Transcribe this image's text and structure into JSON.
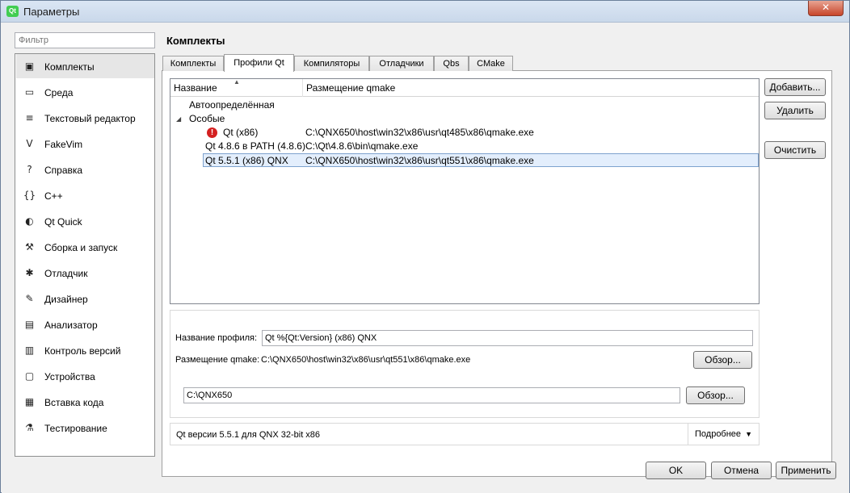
{
  "window": {
    "title": "Параметры",
    "app_icon": "Qt",
    "close_glyph": "✕"
  },
  "filter": {
    "placeholder": "Фильтр"
  },
  "categories": [
    {
      "label": "Комплекты",
      "icon": "kits-icon",
      "glyph": "▣",
      "selected": true
    },
    {
      "label": "Среда",
      "icon": "monitor-icon",
      "glyph": "▭"
    },
    {
      "label": "Текстовый редактор",
      "icon": "text-editor-icon",
      "glyph": "≡"
    },
    {
      "label": "FakeVim",
      "icon": "fakevim-icon",
      "glyph": "V"
    },
    {
      "label": "Справка",
      "icon": "help-icon",
      "glyph": "?"
    },
    {
      "label": "C++",
      "icon": "cpp-braces-icon",
      "glyph": "{}"
    },
    {
      "label": "Qt Quick",
      "icon": "qt-quick-icon",
      "glyph": "◐"
    },
    {
      "label": "Сборка и запуск",
      "icon": "hammer-icon",
      "glyph": "⚒"
    },
    {
      "label": "Отладчик",
      "icon": "bug-icon",
      "glyph": "✱"
    },
    {
      "label": "Дизайнер",
      "icon": "pencil-icon",
      "glyph": "✎"
    },
    {
      "label": "Анализатор",
      "icon": "analyzer-icon",
      "glyph": "▤"
    },
    {
      "label": "Контроль версий",
      "icon": "version-control-icon",
      "glyph": "▥"
    },
    {
      "label": "Устройства",
      "icon": "devices-icon",
      "glyph": "▢"
    },
    {
      "label": "Вставка кода",
      "icon": "code-paste-icon",
      "glyph": "▦"
    },
    {
      "label": "Тестирование",
      "icon": "flask-icon",
      "glyph": "⚗"
    }
  ],
  "page_title": "Комплекты",
  "tabs": [
    {
      "label": "Комплекты"
    },
    {
      "label": "Профили Qt",
      "active": true
    },
    {
      "label": "Компиляторы"
    },
    {
      "label": "Отладчики"
    },
    {
      "label": "Qbs"
    },
    {
      "label": "CMake"
    }
  ],
  "tree": {
    "headers": {
      "name": "Название",
      "location": "Размещение qmake"
    },
    "groups": {
      "auto": "Автоопределённая",
      "manual": "Особые",
      "expander": "◢"
    },
    "rows": [
      {
        "name": "Qt  (x86)",
        "path": "C:\\QNX650\\host\\win32\\x86\\usr\\qt485\\x86\\qmake.exe",
        "error": true,
        "error_glyph": "!"
      },
      {
        "name": "Qt 4.8.6 в PATH (4.8.6)",
        "path": "C:\\Qt\\4.8.6\\bin\\qmake.exe"
      },
      {
        "name": "Qt 5.5.1 (x86) QNX",
        "path": "C:\\QNX650\\host\\win32\\x86\\usr\\qt551\\x86\\qmake.exe",
        "selected": true
      }
    ]
  },
  "side_buttons": {
    "add": "Добавить...",
    "remove": "Удалить",
    "clean": "Очистить"
  },
  "details": {
    "profile_name_label": "Название профиля:",
    "profile_name_value": "Qt %{Qt:Version} (x86) QNX",
    "qmake_label": "Размещение qmake:",
    "qmake_value": "C:\\QNX650\\host\\win32\\x86\\usr\\qt551\\x86\\qmake.exe",
    "browse1": "Обзор...",
    "sdk_path": "C:\\QNX650",
    "browse2": "Обзор..."
  },
  "info": {
    "text": "Qt версии 5.5.1 для QNX 32-bit x86",
    "more": "Подробнее",
    "more_glyph": "▼"
  },
  "footer": {
    "ok": "OK",
    "cancel": "Отмена",
    "apply": "Применить"
  }
}
